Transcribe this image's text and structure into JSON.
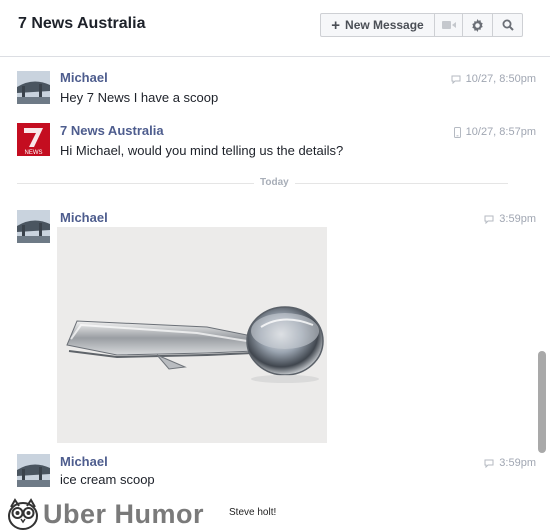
{
  "header": {
    "title": "7 News Australia",
    "new_message_label": "New Message",
    "icons": [
      "plus-icon",
      "video-icon",
      "gear-icon",
      "search-icon"
    ]
  },
  "messages": [
    {
      "sender": "Michael",
      "text": "Hey 7 News I have a scoop",
      "time": "10/27, 8:50pm",
      "source": "web"
    },
    {
      "sender": "7 News Australia",
      "text": "Hi Michael, would you mind telling us the details?",
      "time": "10/27, 8:57pm",
      "source": "mobile"
    },
    {
      "sender": "Michael",
      "text": "",
      "time": "3:59pm",
      "source": "web",
      "attachment": "ice-cream-scoop-photo"
    },
    {
      "sender": "Michael",
      "text": "ice cream scoop",
      "time": "3:59pm",
      "source": "web"
    }
  ],
  "divider_label": "Today",
  "page_logo_text": "7",
  "page_logo_subtext": "NEWS",
  "footer": {
    "brand": "Uber Humor",
    "caption": "Steve holt!"
  },
  "colors": {
    "sender_name": "#4e5d8e",
    "timestamp": "#a0a6b2",
    "page_logo_bg": "#c40d20"
  }
}
